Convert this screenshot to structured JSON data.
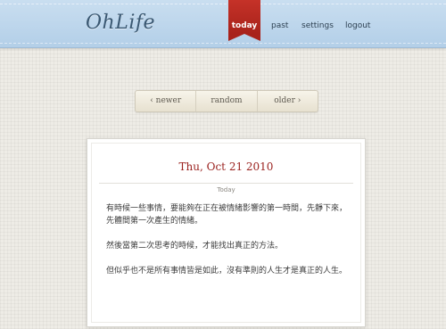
{
  "app": {
    "logo": "OhLife"
  },
  "nav": {
    "today": "today",
    "past": "past",
    "settings": "settings",
    "logout": "logout"
  },
  "pager": {
    "newer": "‹ newer",
    "random": "random",
    "older": "older ›"
  },
  "entry": {
    "date": "Thu, Oct 21 2010",
    "subtitle": "Today",
    "paragraphs": [
      "有時候一些事情，要能夠在正在被情緒影響的第一時間，先靜下來，先體間第一次產生的情緒。",
      "然後當第二次思考的時候，才能找出真正的方法。",
      "但似乎也不是所有事情皆是如此，沒有準則的人生才是真正的人生。"
    ]
  },
  "colors": {
    "topbar": "#b3cfe8",
    "active_tab": "#b02a20",
    "date": "#9b2320"
  }
}
